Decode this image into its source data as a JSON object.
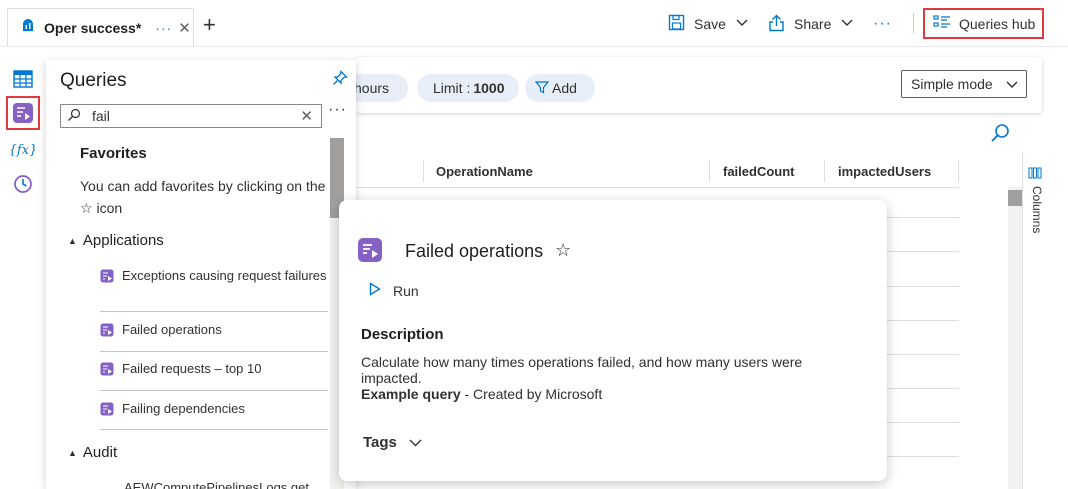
{
  "tab": {
    "title": "Oper success*",
    "more": "···",
    "close": "✕"
  },
  "toolbar": {
    "new_tab": "+",
    "save_label": "Save",
    "share_label": "Share",
    "more": "···",
    "queries_hub_label": "Queries hub"
  },
  "rail": {
    "items": [
      {
        "icon": "table-icon"
      },
      {
        "icon": "queries-icon",
        "selected": true
      },
      {
        "icon": "functions-icon"
      },
      {
        "icon": "history-icon"
      }
    ]
  },
  "queries_panel": {
    "title": "Queries",
    "search_value": "fail",
    "favorites_heading": "Favorites",
    "favorites_hint_part1": "You can add favorites by clicking on the ",
    "favorites_hint_star": "☆",
    "favorites_hint_part2": " icon",
    "groups": [
      {
        "name": "Applications",
        "items": [
          "Exceptions causing request failures",
          "Failed operations",
          "Failed requests – top 10",
          "Failing dependencies"
        ]
      },
      {
        "name": "Audit",
        "items": [
          "AEWComputePipelinesLogs get"
        ]
      }
    ]
  },
  "query_bar": {
    "time_pill": "hours",
    "limit_label": "Limit : ",
    "limit_value": "1000",
    "add_label": "Add",
    "mode_label": "Simple mode"
  },
  "table": {
    "columns": [
      "OperationName",
      "failedCount",
      "impactedUsers"
    ],
    "side_panel_label": "Columns"
  },
  "popup": {
    "title": "Failed operations",
    "star": "☆",
    "run_label": "Run",
    "description_heading": "Description",
    "description": "Calculate how many times operations failed, and how many users were impacted.",
    "example_label": "Example query",
    "example_suffix": " - Created by Microsoft",
    "tags_label": "Tags"
  },
  "colors": {
    "accent": "#0078d4",
    "highlight_border": "#e03a3e",
    "query_icon": "#8661c5"
  }
}
